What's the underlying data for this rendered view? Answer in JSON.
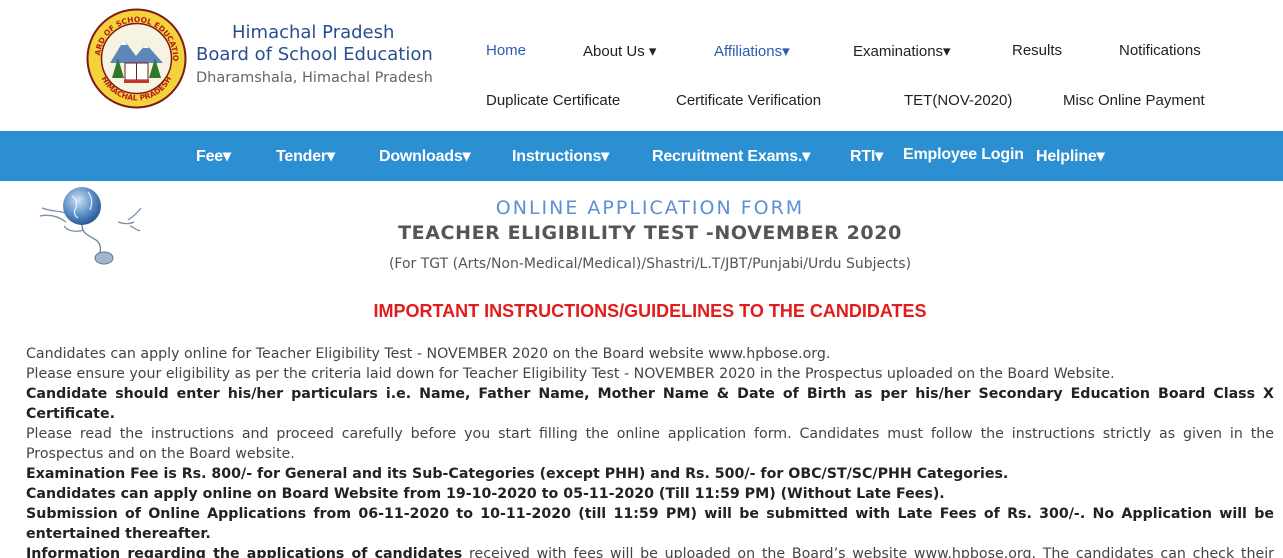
{
  "header": {
    "org_line1": "Himachal Pradesh",
    "org_line2": "Board of School Education",
    "org_line3": "Dharamshala, Himachal Pradesh",
    "logo_ring_top": "BOARD OF SCHOOL EDUCATION",
    "logo_ring_bottom": "HIMACHAL PRADESH"
  },
  "topnav": {
    "home": "Home",
    "about": "About Us ▾",
    "affiliations": "Affiliations▾",
    "examinations": "Examinations▾",
    "results": "Results",
    "notifications": "Notifications",
    "duplicate": "Duplicate Certificate",
    "verification": "Certificate Verification",
    "tet": "TET(NOV-2020)",
    "misc_payment": "Misc Online Payment"
  },
  "mainnav": {
    "fee": "Fee▾",
    "tender": "Tender▾",
    "downloads": "Downloads▾",
    "instructions": "Instructions▾",
    "recruitment": "Recruitment Exams.▾",
    "rti": "RTI▾",
    "employee_login": "Employee Login",
    "helpline": "Helpline▾"
  },
  "form": {
    "title": "ONLINE APPLICATION FORM",
    "subtitle": "TEACHER ELIGIBILITY TEST -NOVEMBER 2020",
    "subjects": "(For TGT (Arts/Non-Medical/Medical)/Shastri/L.T/JBT/Punjabi/Urdu Subjects)",
    "instructions_heading": "IMPORTANT INSTRUCTIONS/GUIDELINES TO THE CANDIDATES"
  },
  "instructions": {
    "p1": "Candidates can apply online for Teacher Eligibility Test - NOVEMBER 2020 on the Board website www.hpbose.org.",
    "p2": "Please ensure your eligibility as per the criteria laid down for Teacher Eligibility Test - NOVEMBER 2020 in the Prospectus uploaded on the Board Website.",
    "p3": "Candidate should enter his/her particulars i.e. Name, Father Name, Mother Name & Date of Birth as per his/her Secondary Education Board Class X Certificate.",
    "p4": "Please read the  instructions and proceed carefully before you start filling the online application form. Candidates must follow the instructions strictly as given in the Prospectus and on the Board website.",
    "p5": "Examination Fee is Rs. 800/- for General and its Sub-Categories (except PHH) and Rs. 500/- for OBC/ST/SC/PHH Categories.",
    "p6": "Candidates can apply online on Board Website from 19-10-2020 to 05-11-2020 (Till 11:59 PM) (Without Late Fees).",
    "p7": "Submission of Online Applications from 06-11-2020 to 10-11-2020 (till 11:59 PM) will be submitted with Late Fees of Rs. 300/-. No Application will be entertained thereafter.",
    "p8_bold": "Information regarding the applications of candidates",
    "p8_rest": " received with fees will be uploaded on the Board’s website www.hpbose.org. The candidates can check their Application for candidature and candidate particulars on the website. The candidature of the candidate, who’s fees has not been received by this Board, will not be"
  },
  "colors": {
    "nav_bar": "#2b8fd2",
    "heading_red": "#e31b1b",
    "title_blue": "#5b8fd6",
    "org_blue": "#2a4f8f"
  }
}
